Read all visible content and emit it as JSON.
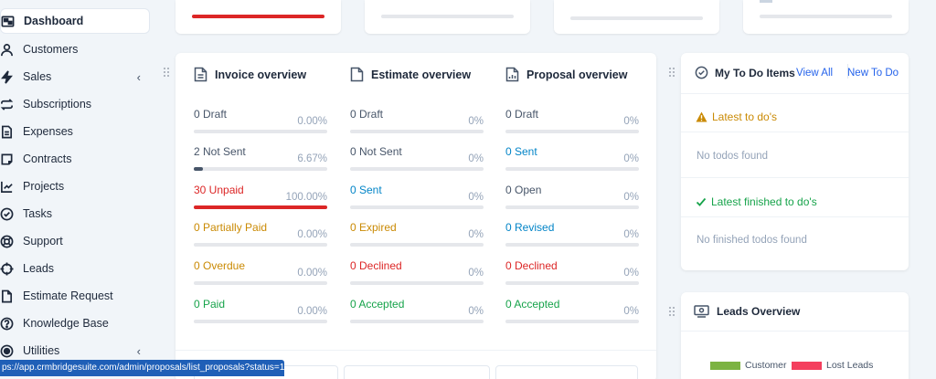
{
  "sidebar": {
    "items": [
      {
        "label": "Dashboard",
        "icon": "dashboard-icon",
        "active": true
      },
      {
        "label": "Customers",
        "icon": "user-icon"
      },
      {
        "label": "Sales",
        "icon": "bolt-icon",
        "has_chevron": true
      },
      {
        "label": "Subscriptions",
        "icon": "repeat-icon"
      },
      {
        "label": "Expenses",
        "icon": "file-icon"
      },
      {
        "label": "Contracts",
        "icon": "contract-icon"
      },
      {
        "label": "Projects",
        "icon": "chart-icon"
      },
      {
        "label": "Tasks",
        "icon": "check-circle-icon"
      },
      {
        "label": "Support",
        "icon": "lifebuoy-icon"
      },
      {
        "label": "Leads",
        "icon": "crosshair-icon"
      },
      {
        "label": "Estimate Request",
        "icon": "document-icon"
      },
      {
        "label": "Knowledge Base",
        "icon": "question-icon"
      },
      {
        "label": "Utilities",
        "icon": "radio-icon",
        "has_chevron": true
      }
    ],
    "chevron": "‹"
  },
  "overview": {
    "columns": [
      {
        "title": "Invoice overview",
        "icon": "invoice-icon",
        "stats": [
          {
            "label": "0 Draft",
            "percent": "0.00%",
            "value": 0,
            "color": "gray"
          },
          {
            "label": "2 Not Sent",
            "percent": "6.67%",
            "value": 6.67,
            "color": "gray"
          },
          {
            "label": "30 Unpaid",
            "percent": "100.00%",
            "value": 100,
            "color": "red"
          },
          {
            "label": "0 Partially Paid",
            "percent": "0.00%",
            "value": 0,
            "color": "amber"
          },
          {
            "label": "0 Overdue",
            "percent": "0.00%",
            "value": 0,
            "color": "amber"
          },
          {
            "label": "0 Paid",
            "percent": "0.00%",
            "value": 0,
            "color": "green"
          }
        ]
      },
      {
        "title": "Estimate overview",
        "icon": "estimate-icon",
        "stats": [
          {
            "label": "0 Draft",
            "percent": "0%",
            "value": 0,
            "color": "gray"
          },
          {
            "label": "0 Not Sent",
            "percent": "0%",
            "value": 0,
            "color": "gray"
          },
          {
            "label": "0 Sent",
            "percent": "0%",
            "value": 0,
            "color": "blue"
          },
          {
            "label": "0 Expired",
            "percent": "0%",
            "value": 0,
            "color": "amber"
          },
          {
            "label": "0 Declined",
            "percent": "0%",
            "value": 0,
            "color": "red"
          },
          {
            "label": "0 Accepted",
            "percent": "0%",
            "value": 0,
            "color": "green"
          }
        ]
      },
      {
        "title": "Proposal overview",
        "icon": "proposal-icon",
        "stats": [
          {
            "label": "0 Draft",
            "percent": "0%",
            "value": 0,
            "color": "gray"
          },
          {
            "label": "0 Sent",
            "percent": "0%",
            "value": 0,
            "color": "blue"
          },
          {
            "label": "0 Open",
            "percent": "0%",
            "value": 0,
            "color": "gray"
          },
          {
            "label": "0 Revised",
            "percent": "0%",
            "value": 0,
            "color": "blue"
          },
          {
            "label": "0 Declined",
            "percent": "0%",
            "value": 0,
            "color": "red"
          },
          {
            "label": "0 Accepted",
            "percent": "0%",
            "value": 0,
            "color": "green"
          }
        ]
      }
    ]
  },
  "top_cards": [
    {
      "progress": 100,
      "color": "#dc2626"
    }
  ],
  "todo": {
    "title": "My To Do Items",
    "view_all": "View All",
    "new_todo": "New To Do",
    "latest_title": "Latest to do's",
    "latest_empty": "No todos found",
    "finished_title": "Latest finished to do's",
    "finished_empty": "No finished todos found"
  },
  "leads": {
    "title": "Leads Overview",
    "legend": [
      {
        "label": "Customer",
        "color": "#7cb342"
      },
      {
        "label": "Lost Leads",
        "color": "#f43f5e"
      }
    ]
  },
  "status_url": "ps://app.crmbridgesuite.com/admin/proposals/list_proposals?status=1",
  "colors": {
    "gray": "#475569",
    "red": "#dc2626",
    "amber": "#ca8a04",
    "green": "#16a34a",
    "blue": "#0284c7",
    "track": "#e5e7eb"
  }
}
